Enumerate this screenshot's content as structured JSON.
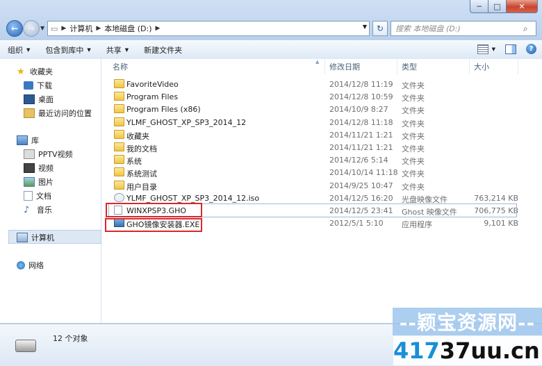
{
  "window": {
    "min_label": "─",
    "max_label": "□",
    "close_label": "✕"
  },
  "address": {
    "segments": [
      "计算机",
      "本地磁盘 (D:)"
    ],
    "search_placeholder": "搜索 本地磁盘 (D:)"
  },
  "toolbar": {
    "organize": "组织",
    "include_library": "包含到库中",
    "share": "共享",
    "new_folder": "新建文件夹"
  },
  "sidebar": {
    "favorites": "收藏夹",
    "downloads": "下载",
    "desktop": "桌面",
    "recent": "最近访问的位置",
    "libraries": "库",
    "pptv": "PPTV视频",
    "videos": "视频",
    "pictures": "图片",
    "documents": "文档",
    "music": "音乐",
    "computer": "计算机",
    "network": "网络"
  },
  "columns": {
    "name": "名称",
    "date": "修改日期",
    "type": "类型",
    "size": "大小"
  },
  "files": [
    {
      "name": "FavoriteVideo",
      "date": "2014/12/8 11:19",
      "type": "文件夹",
      "size": "",
      "kind": "folder"
    },
    {
      "name": "Program Files",
      "date": "2014/12/8 10:59",
      "type": "文件夹",
      "size": "",
      "kind": "folder"
    },
    {
      "name": "Program Files (x86)",
      "date": "2014/10/9 8:27",
      "type": "文件夹",
      "size": "",
      "kind": "folder"
    },
    {
      "name": "YLMF_GHOST_XP_SP3_2014_12",
      "date": "2014/12/8 11:18",
      "type": "文件夹",
      "size": "",
      "kind": "folder"
    },
    {
      "name": "收藏夹",
      "date": "2014/11/21 1:21",
      "type": "文件夹",
      "size": "",
      "kind": "folder"
    },
    {
      "name": "我的文档",
      "date": "2014/11/21 1:21",
      "type": "文件夹",
      "size": "",
      "kind": "folder"
    },
    {
      "name": "系统",
      "date": "2014/12/6 5:14",
      "type": "文件夹",
      "size": "",
      "kind": "folder"
    },
    {
      "name": "系统测试",
      "date": "2014/10/14 11:18",
      "type": "文件夹",
      "size": "",
      "kind": "folder"
    },
    {
      "name": "用户目录",
      "date": "2014/9/25 10:47",
      "type": "文件夹",
      "size": "",
      "kind": "folder"
    },
    {
      "name": "YLMF_GHOST_XP_SP3_2014_12.iso",
      "date": "2014/12/5 16:20",
      "type": "光盘映像文件",
      "size": "763,214 KB",
      "kind": "iso"
    },
    {
      "name": "WINXPSP3.GHO",
      "date": "2014/12/5 23:41",
      "type": "Ghost 映像文件",
      "size": "706,775 KB",
      "kind": "file"
    },
    {
      "name": "GHO镜像安装器.EXE",
      "date": "2012/5/1 5:10",
      "type": "应用程序",
      "size": "9,101 KB",
      "kind": "exe"
    }
  ],
  "status": {
    "count": "12 个对象"
  },
  "watermark": {
    "line1": "--颖宝资源网--",
    "line2a": "417",
    "line2b": "37uu.cn"
  }
}
